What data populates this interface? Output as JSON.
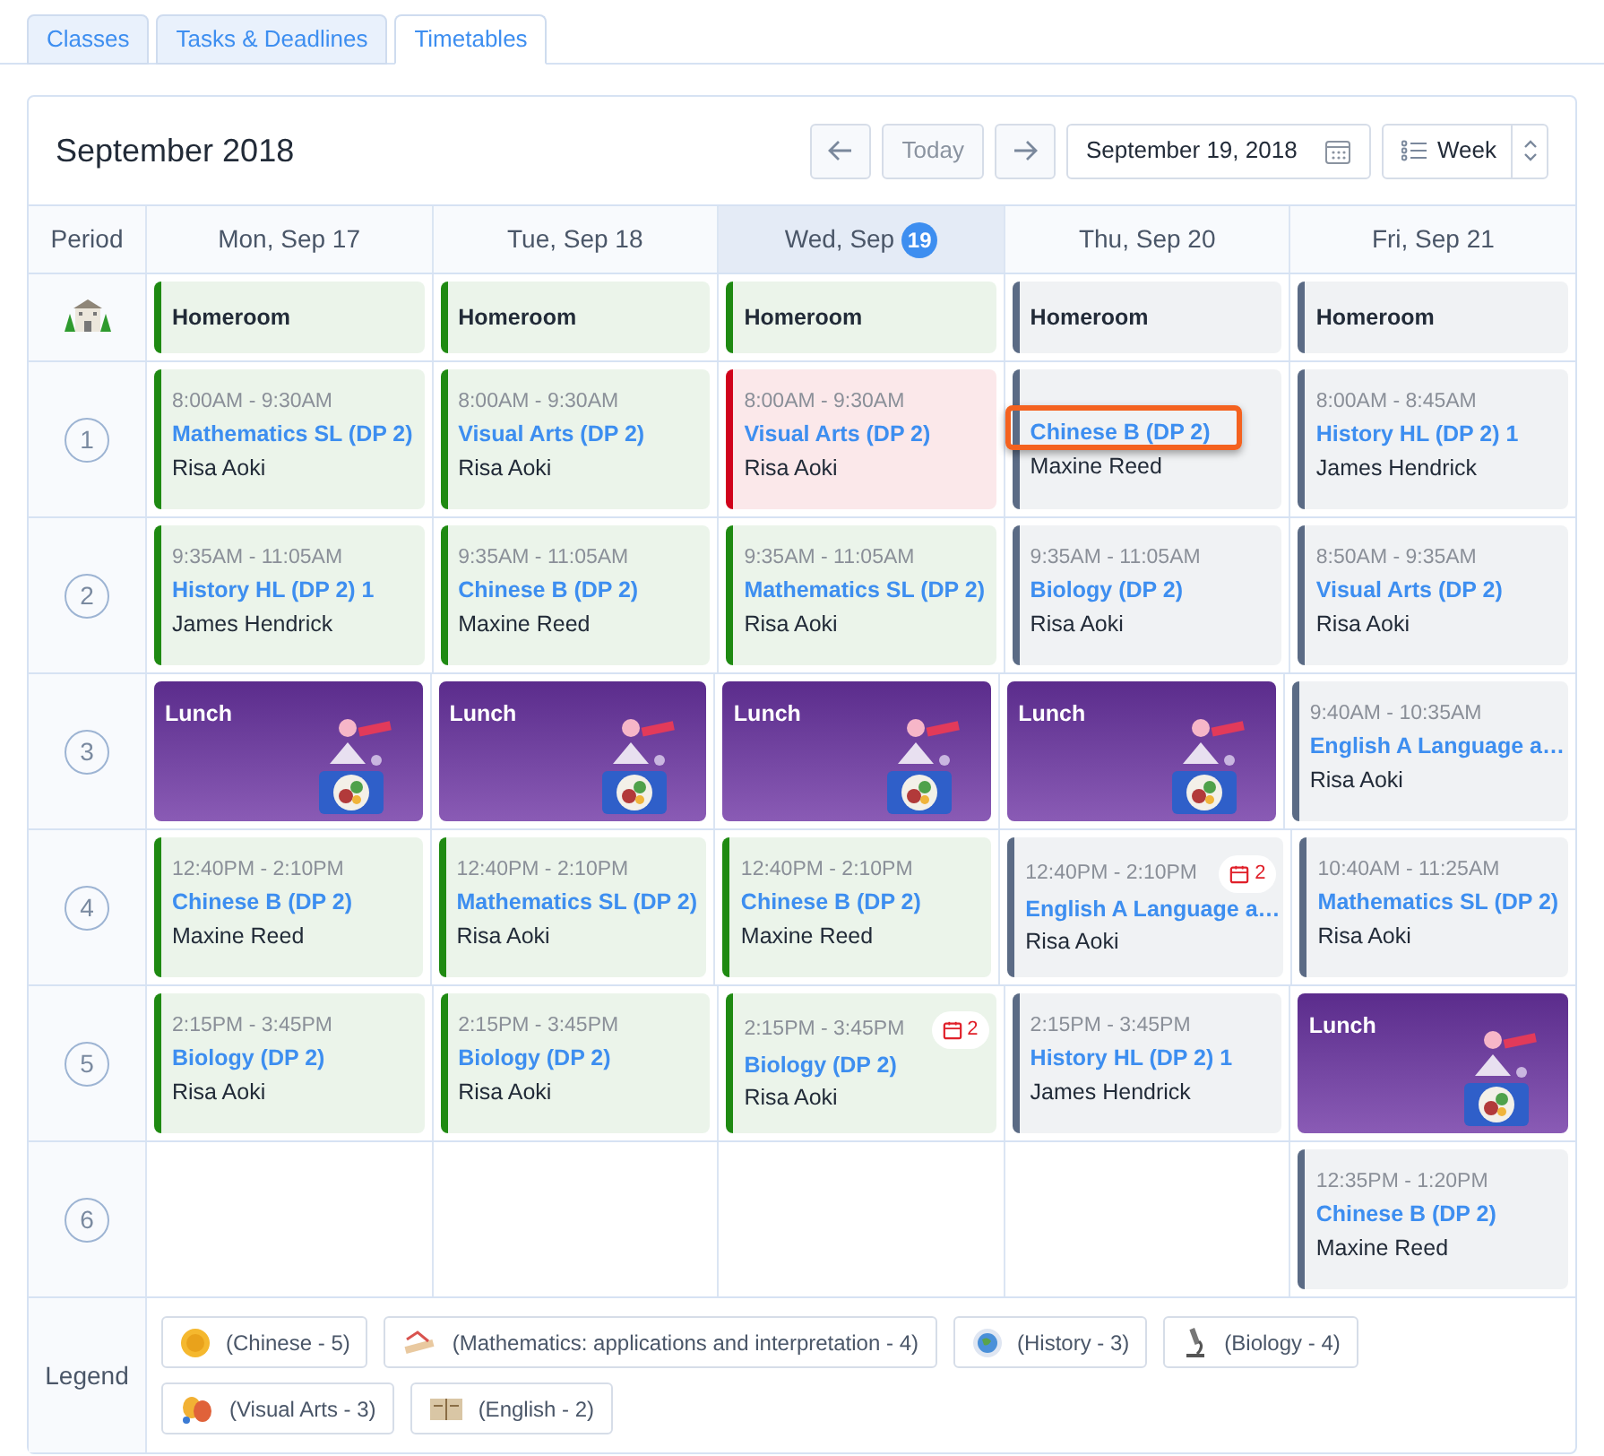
{
  "tabs": [
    {
      "label": "Classes",
      "selected": false
    },
    {
      "label": "Tasks & Deadlines",
      "selected": false
    },
    {
      "label": "Timetables",
      "selected": true
    }
  ],
  "header": {
    "title": "September 2018",
    "today_button": "Today",
    "date_field": "September 19, 2018",
    "view_select": "Week"
  },
  "columns": [
    {
      "label": "Period",
      "today": false
    },
    {
      "label": "Mon, Sep 17",
      "today": false
    },
    {
      "label": "Tue, Sep 18",
      "today": false
    },
    {
      "label": "Wed, Sep",
      "day_badge": "19",
      "today": true
    },
    {
      "label": "Thu, Sep 20",
      "today": false
    },
    {
      "label": "Fri, Sep 21",
      "today": false
    }
  ],
  "rows": [
    {
      "kind": "homeroom",
      "cells": [
        {
          "kind": "homeroom",
          "title": "Homeroom",
          "color": "#1f8a12"
        },
        {
          "kind": "homeroom",
          "title": "Homeroom",
          "color": "#1f8a12"
        },
        {
          "kind": "homeroom",
          "title": "Homeroom",
          "color": "#1f8a12"
        },
        {
          "kind": "homeroom",
          "title": "Homeroom",
          "color": "#5b6b85"
        },
        {
          "kind": "homeroom",
          "title": "Homeroom",
          "color": "#5b6b85"
        }
      ]
    },
    {
      "kind": "period",
      "label": "1",
      "cells": [
        {
          "kind": "class",
          "time": "8:00AM - 9:30AM",
          "title": "Mathematics SL (DP 2)",
          "teacher": "Risa Aoki",
          "color": "#1f8a12"
        },
        {
          "kind": "class",
          "time": "8:00AM - 9:30AM",
          "title": "Visual Arts (DP 2)",
          "teacher": "Risa Aoki",
          "color": "#1f8a12"
        },
        {
          "kind": "class",
          "time": "8:00AM - 9:30AM",
          "title": "Visual Arts (DP 2)",
          "teacher": "Risa Aoki",
          "color": "#d0021b"
        },
        {
          "kind": "class",
          "title": "Chinese B (DP 2)",
          "teacher": "Maxine Reed",
          "color": "#5b6b85",
          "highlighted": true
        },
        {
          "kind": "class",
          "time": "8:00AM - 8:45AM",
          "title": "History HL (DP 2) 1",
          "teacher": "James Hendrick",
          "color": "#5b6b85"
        }
      ]
    },
    {
      "kind": "period",
      "label": "2",
      "cells": [
        {
          "kind": "class",
          "time": "9:35AM - 11:05AM",
          "title": "History HL (DP 2) 1",
          "teacher": "James Hendrick",
          "color": "#1f8a12"
        },
        {
          "kind": "class",
          "time": "9:35AM - 11:05AM",
          "title": "Chinese B (DP 2)",
          "teacher": "Maxine Reed",
          "color": "#1f8a12"
        },
        {
          "kind": "class",
          "time": "9:35AM - 11:05AM",
          "title": "Mathematics SL (DP 2)",
          "teacher": "Risa Aoki",
          "color": "#1f8a12"
        },
        {
          "kind": "class",
          "time": "9:35AM - 11:05AM",
          "title": "Biology (DP 2)",
          "teacher": "Risa Aoki",
          "color": "#5b6b85"
        },
        {
          "kind": "class",
          "time": "8:50AM - 9:35AM",
          "title": "Visual Arts (DP 2)",
          "teacher": "Risa Aoki",
          "color": "#5b6b85"
        }
      ]
    },
    {
      "kind": "period",
      "label": "3",
      "cells": [
        {
          "kind": "lunch",
          "title": "Lunch"
        },
        {
          "kind": "lunch",
          "title": "Lunch"
        },
        {
          "kind": "lunch",
          "title": "Lunch"
        },
        {
          "kind": "lunch",
          "title": "Lunch"
        },
        {
          "kind": "class",
          "time": "9:40AM - 10:35AM",
          "title": "English A Language a…",
          "teacher": "Risa Aoki",
          "color": "#5b6b85"
        }
      ]
    },
    {
      "kind": "period",
      "label": "4",
      "cells": [
        {
          "kind": "class",
          "time": "12:40PM - 2:10PM",
          "title": "Chinese B (DP 2)",
          "teacher": "Maxine Reed",
          "color": "#1f8a12"
        },
        {
          "kind": "class",
          "time": "12:40PM - 2:10PM",
          "title": "Mathematics SL (DP 2)",
          "teacher": "Risa Aoki",
          "color": "#1f8a12"
        },
        {
          "kind": "class",
          "time": "12:40PM - 2:10PM",
          "title": "Chinese B (DP 2)",
          "teacher": "Maxine Reed",
          "color": "#1f8a12"
        },
        {
          "kind": "class",
          "time": "12:40PM - 2:10PM",
          "title": "English A Language a…",
          "teacher": "Risa Aoki",
          "color": "#5b6b85",
          "badge": "2"
        },
        {
          "kind": "class",
          "time": "10:40AM - 11:25AM",
          "title": "Mathematics SL (DP 2)",
          "teacher": "Risa Aoki",
          "color": "#5b6b85"
        }
      ]
    },
    {
      "kind": "period",
      "label": "5",
      "cells": [
        {
          "kind": "class",
          "time": "2:15PM - 3:45PM",
          "title": "Biology (DP 2)",
          "teacher": "Risa Aoki",
          "color": "#1f8a12"
        },
        {
          "kind": "class",
          "time": "2:15PM - 3:45PM",
          "title": "Biology (DP 2)",
          "teacher": "Risa Aoki",
          "color": "#1f8a12"
        },
        {
          "kind": "class",
          "time": "2:15PM - 3:45PM",
          "title": "Biology (DP 2)",
          "teacher": "Risa Aoki",
          "color": "#1f8a12",
          "badge": "2"
        },
        {
          "kind": "class",
          "time": "2:15PM - 3:45PM",
          "title": "History HL (DP 2) 1",
          "teacher": "James Hendrick",
          "color": "#5b6b85"
        },
        {
          "kind": "lunch",
          "title": "Lunch"
        }
      ]
    },
    {
      "kind": "period",
      "label": "6",
      "cells": [
        {
          "kind": "empty"
        },
        {
          "kind": "empty"
        },
        {
          "kind": "empty"
        },
        {
          "kind": "empty"
        },
        {
          "kind": "class",
          "time": "12:35PM - 1:20PM",
          "title": "Chinese B (DP 2)",
          "teacher": "Maxine Reed",
          "color": "#5b6b85"
        }
      ]
    }
  ],
  "legend": {
    "label": "Legend",
    "items": [
      {
        "kind": "chinese",
        "label": "(Chinese - 5)"
      },
      {
        "kind": "math",
        "label": "(Mathematics: applications and interpretation - 4)"
      },
      {
        "kind": "history",
        "label": "(History - 3)"
      },
      {
        "kind": "biology",
        "label": "(Biology - 4)"
      },
      {
        "kind": "arts",
        "label": "(Visual Arts - 3)"
      },
      {
        "kind": "english",
        "label": "(English - 2)"
      }
    ]
  }
}
